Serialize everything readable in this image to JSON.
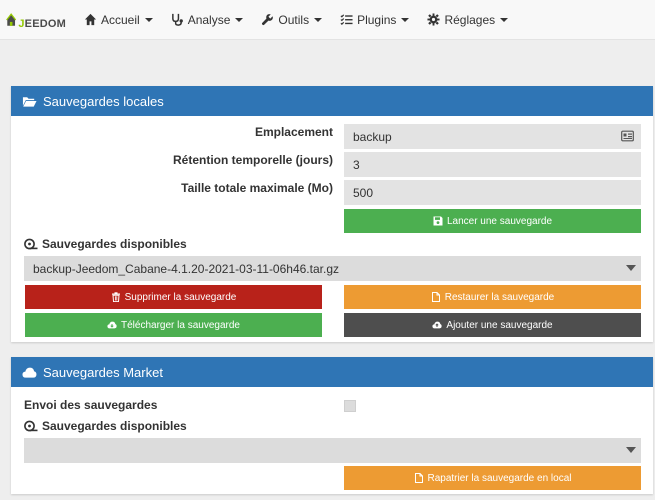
{
  "app": {
    "logo_initial": "J",
    "logo_rest": "EEDOM"
  },
  "navbar": {
    "items": [
      {
        "label": "Accueil",
        "icon": "home-icon"
      },
      {
        "label": "Analyse",
        "icon": "stethoscope-icon"
      },
      {
        "label": "Outils",
        "icon": "wrench-icon"
      },
      {
        "label": "Plugins",
        "icon": "tasks-icon"
      },
      {
        "label": "Réglages",
        "icon": "cog-icon"
      }
    ]
  },
  "local_backups": {
    "title": "Sauvegardes locales",
    "location_label": "Emplacement",
    "location_value": "backup",
    "retention_label": "Rétention temporelle (jours)",
    "retention_value": "3",
    "max_size_label": "Taille totale maximale (Mo)",
    "max_size_value": "500",
    "launch_button": "Lancer une sauvegarde",
    "available_label": "Sauvegardes disponibles",
    "selected_backup": "backup-Jeedom_Cabane-4.1.20-2021-03-11-06h46.tar.gz",
    "delete_button": "Supprimer la sauvegarde",
    "restore_button": "Restaurer la sauvegarde",
    "download_button": "Télécharger la sauvegarde",
    "add_button": "Ajouter une sauvegarde"
  },
  "market_backups": {
    "title": "Sauvegardes Market",
    "send_label": "Envoi des sauvegardes",
    "send_checked": false,
    "available_label": "Sauvegardes disponibles",
    "selected_backup": "",
    "repatriate_button": "Rapatrier la sauvegarde en local"
  },
  "colors": {
    "primary": "#2f75b5",
    "success": "#4caf50",
    "danger": "#b8221a",
    "warning": "#ed9b33",
    "dark": "#4e4e4e",
    "logo_green": "#94ca02"
  }
}
